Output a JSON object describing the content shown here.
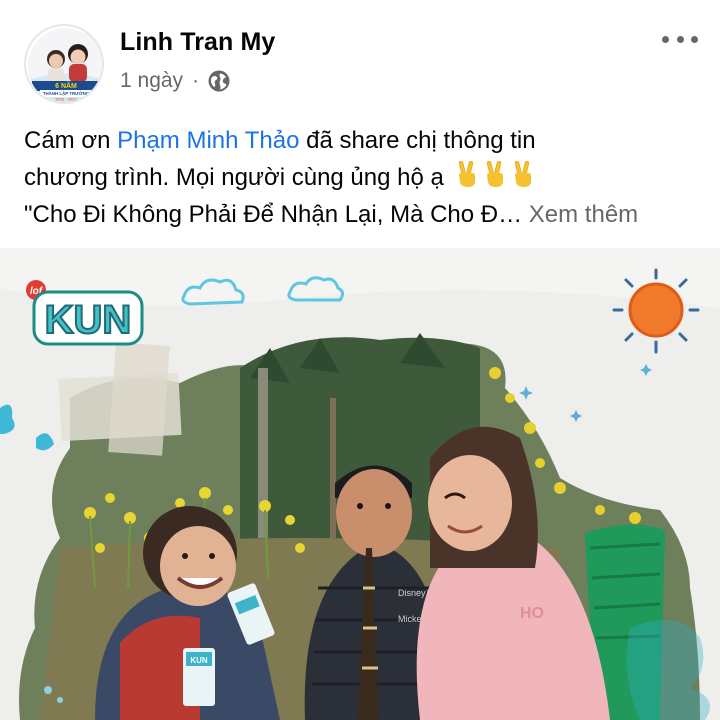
{
  "post": {
    "author": "Linh Tran My",
    "time": "1 ngày",
    "separator": "·",
    "privacy_icon": "globe-icon",
    "more_icon": "more-options-icon",
    "text": {
      "line1_prefix": "Cám ơn ",
      "mention": "Phạm Minh Thảo",
      "line1_suffix": " đã share chị thông tin",
      "line2": "chương trình. Mọi người cùng ủng hộ ạ",
      "emoji": "victory-hand-icon",
      "line3": "\"Cho Đi Không Phải Để Nhận Lại, Mà Cho Đ…",
      "see_more": "Xem thêm"
    }
  },
  "avatar": {
    "banner_text": "6 NĂM",
    "banner_sub": "THÀNH LẬP TRƯỜNG",
    "years": "2016 - 2022"
  },
  "image": {
    "brand_small": "lof",
    "brand": "KUN",
    "box_label": "KUN",
    "jacket_text": "Disney",
    "jacket_text2": "Mickey",
    "hoodie_text": "HO"
  },
  "colors": {
    "link": "#1b74e4",
    "secondary_text": "#65676b",
    "brand_teal": "#1e8c85",
    "sun_orange": "#f07a2a"
  }
}
